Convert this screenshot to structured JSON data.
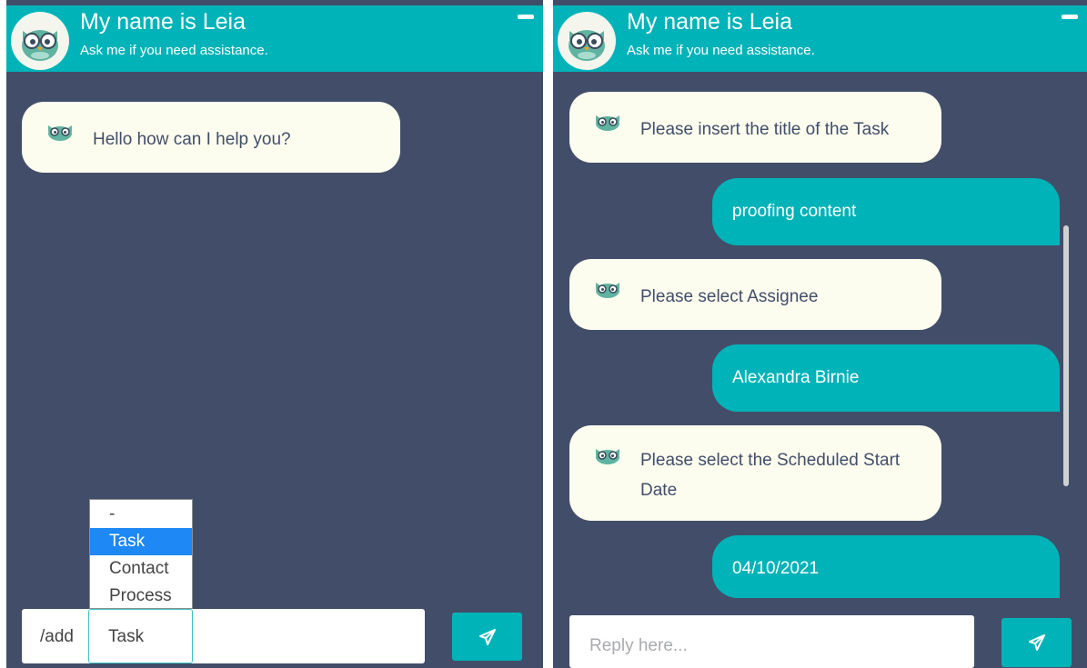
{
  "header": {
    "title": "My name is Leia",
    "subtitle": "Ask me if you need assistance."
  },
  "left": {
    "messages": [
      {
        "from": "bot",
        "text": "Hello how can I help you?"
      }
    ],
    "dropdown": {
      "options": [
        "-",
        "Task",
        "Contact",
        "Process"
      ],
      "selected": "Task"
    },
    "input": {
      "command": "/add",
      "value": "Task"
    }
  },
  "right": {
    "messages": [
      {
        "from": "bot",
        "text": "Please insert the title of the Task"
      },
      {
        "from": "user",
        "text": "proofing content"
      },
      {
        "from": "bot",
        "text": "Please select Assignee"
      },
      {
        "from": "user",
        "text": "Alexandra Birnie"
      },
      {
        "from": "bot",
        "text": "Please select the Scheduled Start Date"
      },
      {
        "from": "user",
        "text": "04/10/2021"
      }
    ],
    "input": {
      "placeholder": "Reply here..."
    }
  },
  "icons": [
    "owl-avatar-icon",
    "owl-icon",
    "send-icon",
    "minimize-icon"
  ],
  "colors": {
    "teal": "#00b3b8",
    "panel": "#424e69",
    "bot_bubble": "#fdfdef",
    "dropdown_highlight": "#1e88f4"
  }
}
